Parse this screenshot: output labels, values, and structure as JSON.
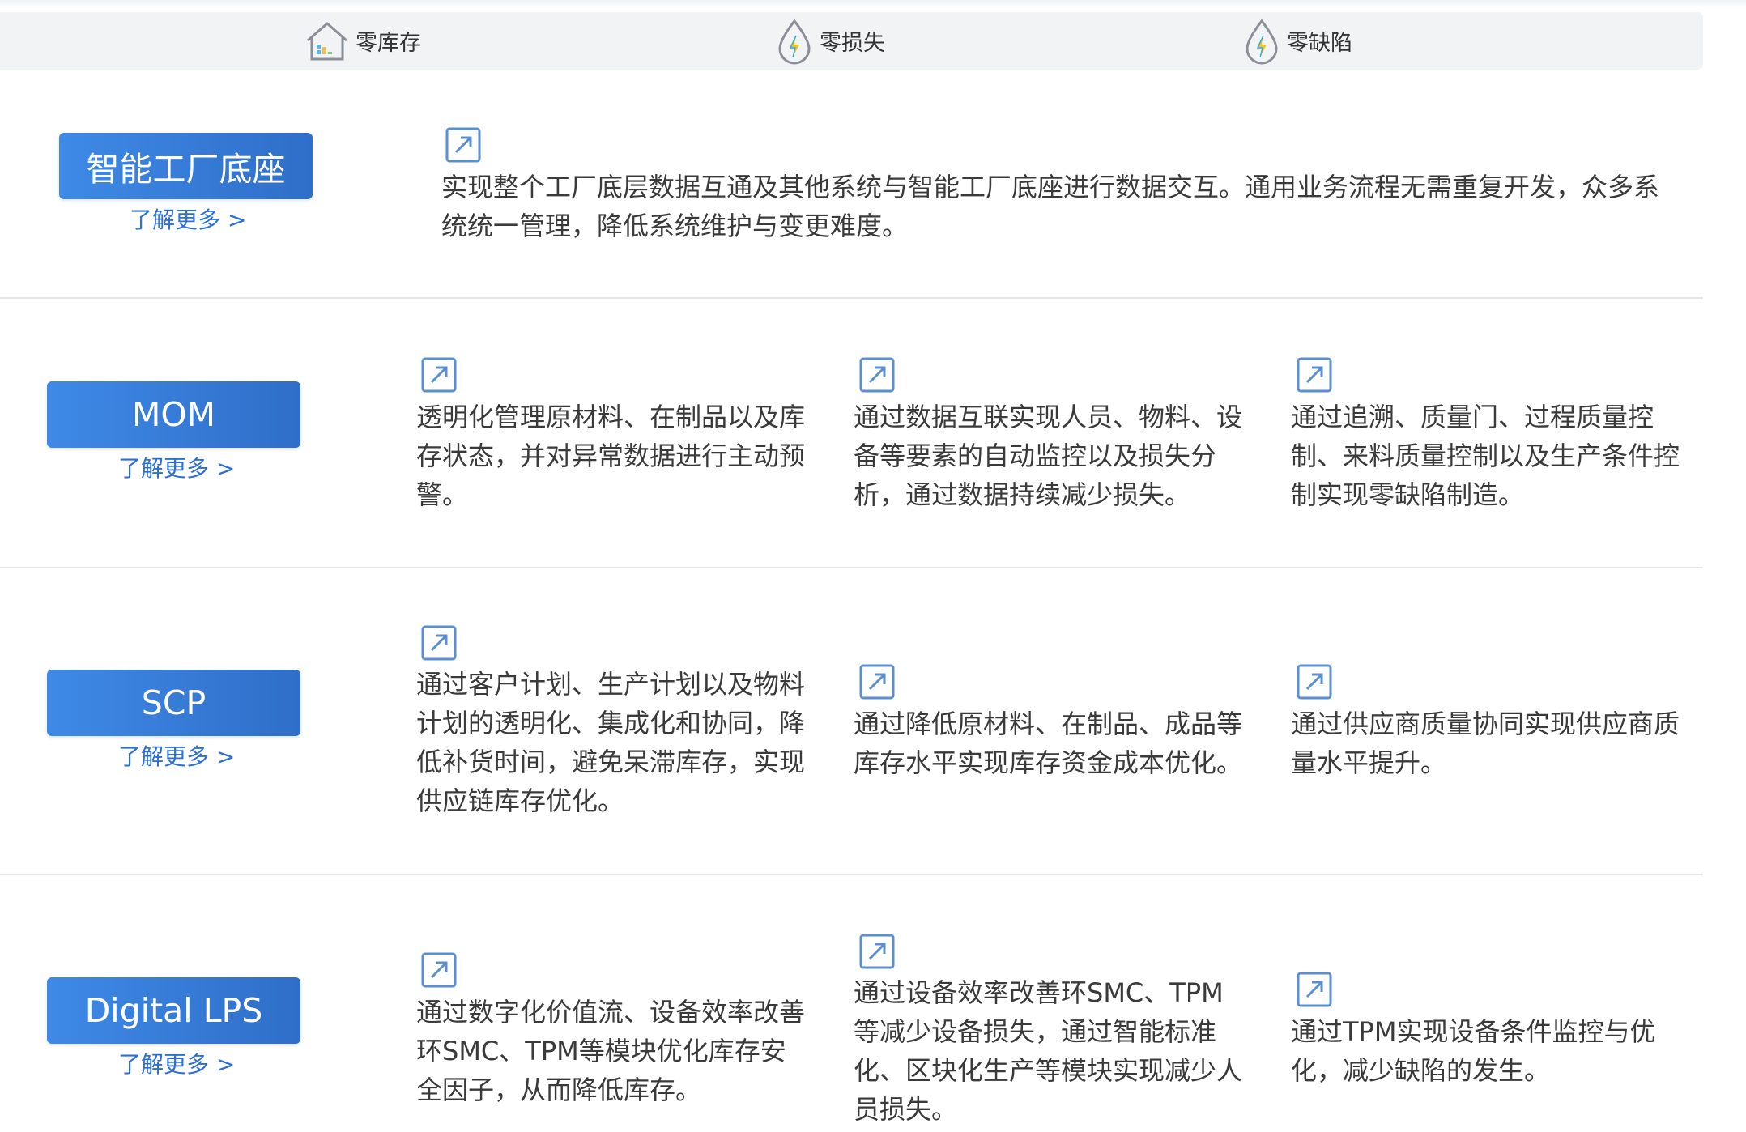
{
  "header": {
    "items": [
      {
        "label": "零库存",
        "icon": "house-chart-icon"
      },
      {
        "label": "零损失",
        "icon": "water-drop-lightning-icon"
      },
      {
        "label": "零缺陷",
        "icon": "water-drop-lightning-icon"
      }
    ]
  },
  "colors": {
    "button": "#3e8ae6",
    "link": "#2c6fd8",
    "header_bg": "#f2f3f5",
    "icon": "#5b8fd0"
  },
  "rows": [
    {
      "button": "智能工厂底座",
      "more": "了解更多 >",
      "features": [
        {
          "lines": [
            "实现整个工厂底层数据互通及其他系统与智能工厂底座进行数据交互。通用业务流程无需重复开发，众多系",
            "统统一管理，降低系统维护与变更难度。"
          ]
        }
      ]
    },
    {
      "button": "MOM",
      "more": "了解更多 >",
      "features": [
        {
          "lines": [
            "透明化管理原材料、在制品以及库",
            "存状态，并对异常数据进行主动预",
            "警。"
          ]
        },
        {
          "lines": [
            "通过数据互联实现人员、物料、设",
            "备等要素的自动监控以及损失分",
            "析，通过数据持续减少损失。"
          ]
        },
        {
          "lines": [
            "通过追溯、质量门、过程质量控",
            "制、来料质量控制以及生产条件控",
            "制实现零缺陷制造。"
          ]
        }
      ]
    },
    {
      "button": "SCP",
      "more": "了解更多 >",
      "features": [
        {
          "lines": [
            "通过客户计划、生产计划以及物料",
            "计划的透明化、集成化和协同，降",
            "低补货时间，避免呆滞库存，实现",
            "供应链库存优化。"
          ]
        },
        {
          "lines": [
            "通过降低原材料、在制品、成品等",
            "库存水平实现库存资金成本优化。"
          ]
        },
        {
          "lines": [
            "通过供应商质量协同实现供应商质",
            "量水平提升。"
          ]
        }
      ]
    },
    {
      "button": "Digital LPS",
      "more": "了解更多 >",
      "features": [
        {
          "lines": [
            "通过数字化价值流、设备效率改善",
            "环SMC、TPM等模块优化库存安",
            "全因子，从而降低库存。"
          ]
        },
        {
          "lines": [
            "通过设备效率改善环SMC、TPM",
            "等减少设备损失，通过智能标准",
            "化、区块化生产等模块实现减少人",
            "员损失。"
          ]
        },
        {
          "lines": [
            "通过TPM实现设备条件监控与优",
            "化，减少缺陷的发生。"
          ]
        }
      ]
    }
  ]
}
